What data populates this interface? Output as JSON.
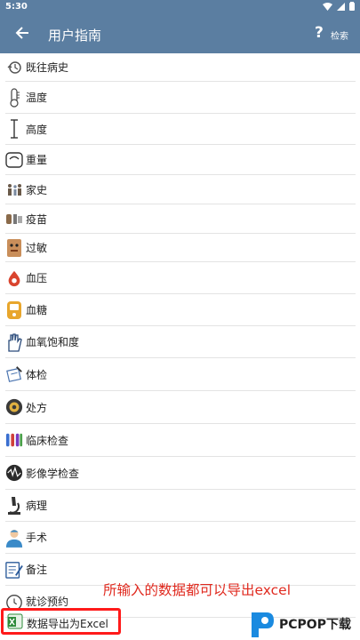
{
  "status": {
    "time": "5:30"
  },
  "header": {
    "title": "用户指南",
    "help_label": "?",
    "search_label": "检索"
  },
  "items": [
    {
      "label": "既往病史",
      "icon": "history-icon"
    },
    {
      "label": "温度",
      "icon": "thermometer-icon"
    },
    {
      "label": "高度",
      "icon": "height-icon"
    },
    {
      "label": "重量",
      "icon": "scale-icon"
    },
    {
      "label": "家史",
      "icon": "family-icon"
    },
    {
      "label": "疫苗",
      "icon": "vaccine-icon"
    },
    {
      "label": "过敏",
      "icon": "allergy-icon"
    },
    {
      "label": "血压",
      "icon": "blood-pressure-icon"
    },
    {
      "label": "血糖",
      "icon": "glucose-meter-icon"
    },
    {
      "label": "血氧饱和度",
      "icon": "hand-oximeter-icon"
    },
    {
      "label": "体检",
      "icon": "checkup-icon"
    },
    {
      "label": "处方",
      "icon": "prescription-icon"
    },
    {
      "label": "临床检查",
      "icon": "test-tubes-icon"
    },
    {
      "label": "影像学检查",
      "icon": "imaging-icon"
    },
    {
      "label": "病理",
      "icon": "microscope-icon"
    },
    {
      "label": "手术",
      "icon": "surgeon-icon"
    },
    {
      "label": "备注",
      "icon": "notes-icon"
    },
    {
      "label": "就诊预约",
      "icon": "appointment-clock-icon"
    }
  ],
  "export_item": {
    "label": "数据导出为Excel",
    "icon": "excel-icon"
  },
  "annotation": "所输入的数据都可以导出excel",
  "watermark": {
    "brand": "PCPOP下载"
  },
  "colors": {
    "appbar": "#5b7ea1",
    "annotation": "#e02a1f",
    "highlight": "#ff1a1a"
  }
}
